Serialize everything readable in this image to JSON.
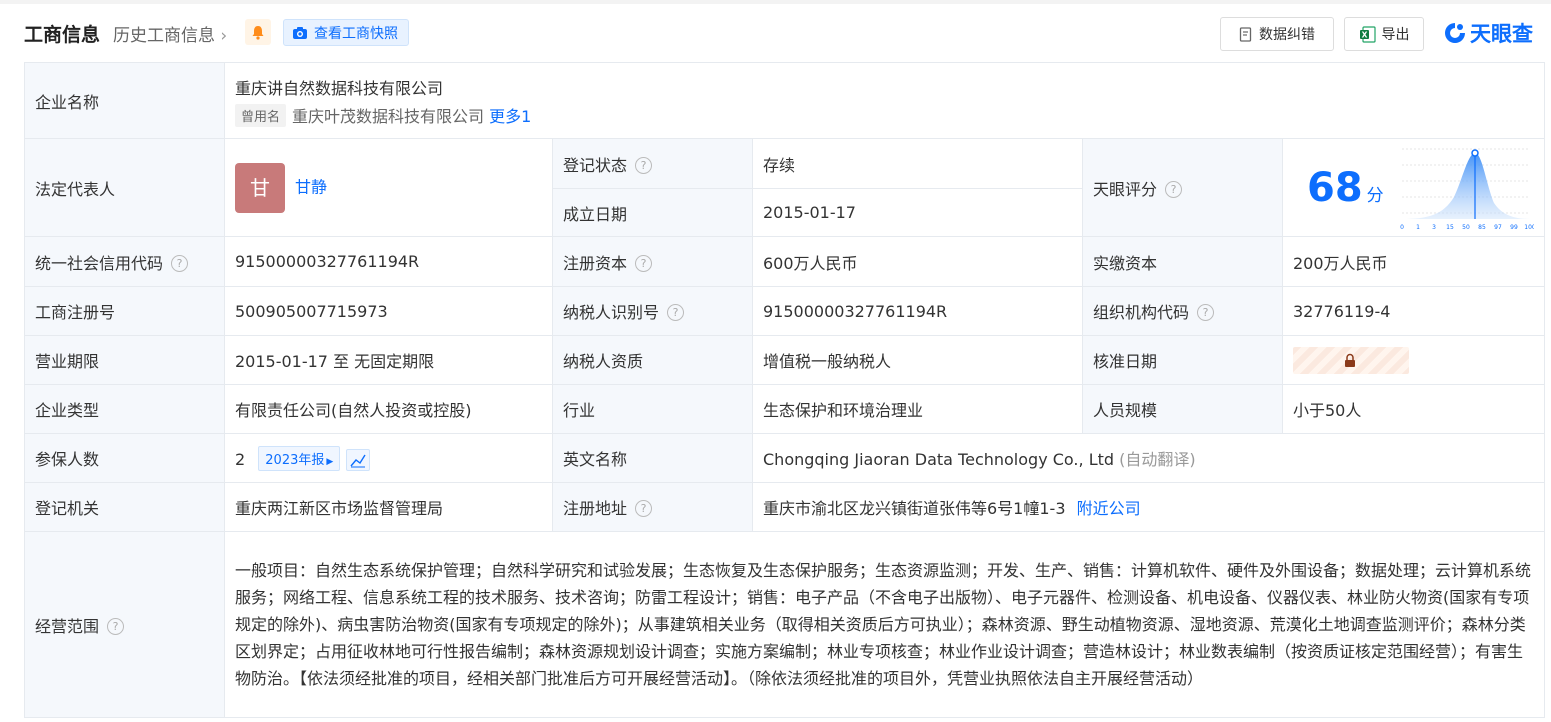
{
  "header": {
    "title": "工商信息",
    "history_label": "历史工商信息",
    "snapshot_label": "查看工商快照",
    "correct_label": "数据纠错",
    "export_label": "导出",
    "logo_text": "天眼查"
  },
  "company": {
    "name_label": "企业名称",
    "name": "重庆讲自然数据科技有限公司",
    "former_tag": "曾用名",
    "former_name": "重庆叶茂数据科技有限公司",
    "more_link": "更多1"
  },
  "legal": {
    "label": "法定代表人",
    "avatar_char": "甘",
    "name": "甘静"
  },
  "status": {
    "label": "登记状态",
    "value": "存续",
    "date_label": "成立日期",
    "date_value": "2015-01-17"
  },
  "score": {
    "label": "天眼评分",
    "value": "68",
    "unit": "分",
    "ticks": [
      "0",
      "1",
      "3",
      "15",
      "50",
      "85",
      "97",
      "99",
      "100"
    ]
  },
  "rows": {
    "credit_label": "统一社会信用代码",
    "credit_value": "91500000327761194R",
    "capital_label": "注册资本",
    "capital_value": "600万人民币",
    "paid_label": "实缴资本",
    "paid_value": "200万人民币",
    "regno_label": "工商注册号",
    "regno_value": "500905007715973",
    "taxid_label": "纳税人识别号",
    "taxid_value": "91500000327761194R",
    "org_label": "组织机构代码",
    "org_value": "32776119-4",
    "term_label": "营业期限",
    "term_value": "2015-01-17 至 无固定期限",
    "taxq_label": "纳税人资质",
    "taxq_value": "增值税一般纳税人",
    "approve_label": "核准日期",
    "type_label": "企业类型",
    "type_value": "有限责任公司(自然人投资或控股)",
    "industry_label": "行业",
    "industry_value": "生态保护和环境治理业",
    "staff_label": "人员规模",
    "staff_value": "小于50人",
    "insured_label": "参保人数",
    "insured_value": "2",
    "report_tag": "2023年报",
    "en_label": "英文名称",
    "en_value": "Chongqing Jiaoran Data Technology Co., Ltd",
    "en_note": "(自动翻译)",
    "authority_label": "登记机关",
    "authority_value": "重庆两江新区市场监督管理局",
    "addr_label": "注册地址",
    "addr_value": "重庆市渝北区龙兴镇街道张伟等6号1幢1-3",
    "nearby_link": "附近公司",
    "scope_label": "经营范围",
    "scope_value": "一般项目：自然生态系统保护管理；自然科学研究和试验发展；生态恢复及生态保护服务；生态资源监测；开发、生产、销售：计算机软件、硬件及外围设备；数据处理；云计算机系统服务；网络工程、信息系统工程的技术服务、技术咨询；防雷工程设计；销售：电子产品（不含电子出版物）、电子元器件、检测设备、机电设备、仪器仪表、林业防火物资(国家有专项规定的除外)、病虫害防治物资(国家有专项规定的除外)；从事建筑相关业务（取得相关资质后方可执业）；森林资源、野生动植物资源、湿地资源、荒漠化土地调查监测评价；森林分类区划界定；占用征收林地可行性报告编制；森林资源规划设计调查；实施方案编制；林业专项核查；林业作业设计调查；营造林设计；林业数表编制（按资质证核定范围经营）；有害生物防治。【依法须经批准的项目，经相关部门批准后方可开展经营活动】。（除依法须经批准的项目外，凭营业执照依法自主开展经营活动）"
  },
  "colors": {
    "accent": "#0d6efd",
    "status_green": "#2ea44f",
    "label_bg": "#f5f8fc",
    "avatar_bg": "#c87a7a"
  }
}
